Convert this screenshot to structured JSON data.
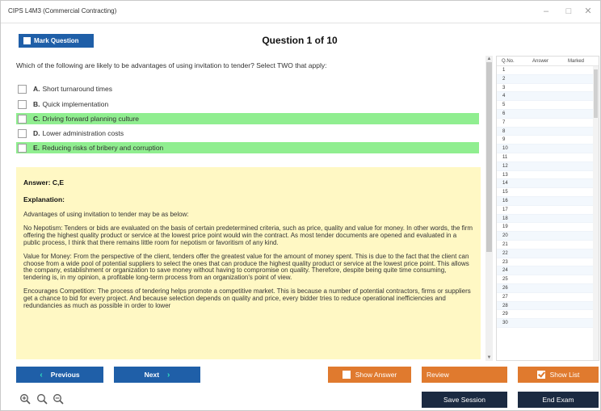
{
  "window": {
    "title": "CIPS L4M3 (Commercial Contracting)",
    "minimize": "–",
    "maximize": "□",
    "close": "✕"
  },
  "header": {
    "mark_label": "Mark Question",
    "question_counter": "Question 1 of 10"
  },
  "question": {
    "text": "Which of the following are likely to be advantages of using invitation to tender? Select TWO that apply:",
    "options": [
      {
        "letter": "A.",
        "text": "Short turnaround times",
        "correct": false
      },
      {
        "letter": "B.",
        "text": "Quick implementation",
        "correct": false
      },
      {
        "letter": "C.",
        "text": "Driving forward planning culture",
        "correct": true
      },
      {
        "letter": "D.",
        "text": "Lower administration costs",
        "correct": false
      },
      {
        "letter": "E.",
        "text": "Reducing risks of bribery and corruption",
        "correct": true
      }
    ]
  },
  "explanation": {
    "answer": "Answer: C,E",
    "heading": "Explanation:",
    "paragraphs": [
      "Advantages of using invitation to tender may be as below:",
      "No Nepotism: Tenders or bids are evaluated on the basis of certain predetermined criteria, such as price, quality and value for money. In other words, the firm offering the highest quality product or service at the lowest price point would win the contract. As most tender documents are opened and evaluated in a public process, I think that there remains little room for nepotism or favoritism of any kind.",
      "Value for Money: From the perspective of the client, tenders offer the greatest value for the amount of money spent. This is due to the fact that the client can choose from a wide pool of potential suppliers to select the ones that can produce the highest quality product or service at the lowest price point. This allows the company, establishment or organization to save money without having to compromise on quality. Therefore, despite being quite time consuming, tendering is, in my opinion, a profitable long-term process from an organization's point of view.",
      "Encourages Competition: The process of tendering helps promote a competitive market. This is because a number of potential contractors, firms or suppliers get a chance to bid for every project. And because selection depends on quality and price, every bidder tries to reduce operational inefficiencies and redundancies as much as possible in order to lower"
    ]
  },
  "question_list": {
    "headers": [
      "Q.No.",
      "Answer",
      "Marked"
    ],
    "rows": [
      "1",
      "2",
      "3",
      "4",
      "5",
      "6",
      "7",
      "8",
      "9",
      "10",
      "11",
      "12",
      "13",
      "14",
      "15",
      "16",
      "17",
      "18",
      "19",
      "20",
      "21",
      "22",
      "23",
      "24",
      "25",
      "26",
      "27",
      "28",
      "29",
      "30"
    ]
  },
  "footer": {
    "previous": "Previous",
    "next": "Next",
    "show_answer": "Show Answer",
    "review": "Review",
    "show_list": "Show List",
    "save_session": "Save Session",
    "end_exam": "End Exam",
    "prev_arrow": "‹",
    "next_arrow": "›"
  },
  "icons": [
    "zoom-in-icon",
    "zoom-reset-icon",
    "zoom-out-icon"
  ],
  "colors": {
    "primary_blue": "#1f5fa8",
    "orange": "#e07a2e",
    "navy": "#1b2a41",
    "correct_green": "#90ee90",
    "explanation_bg": "#fff8c4"
  }
}
